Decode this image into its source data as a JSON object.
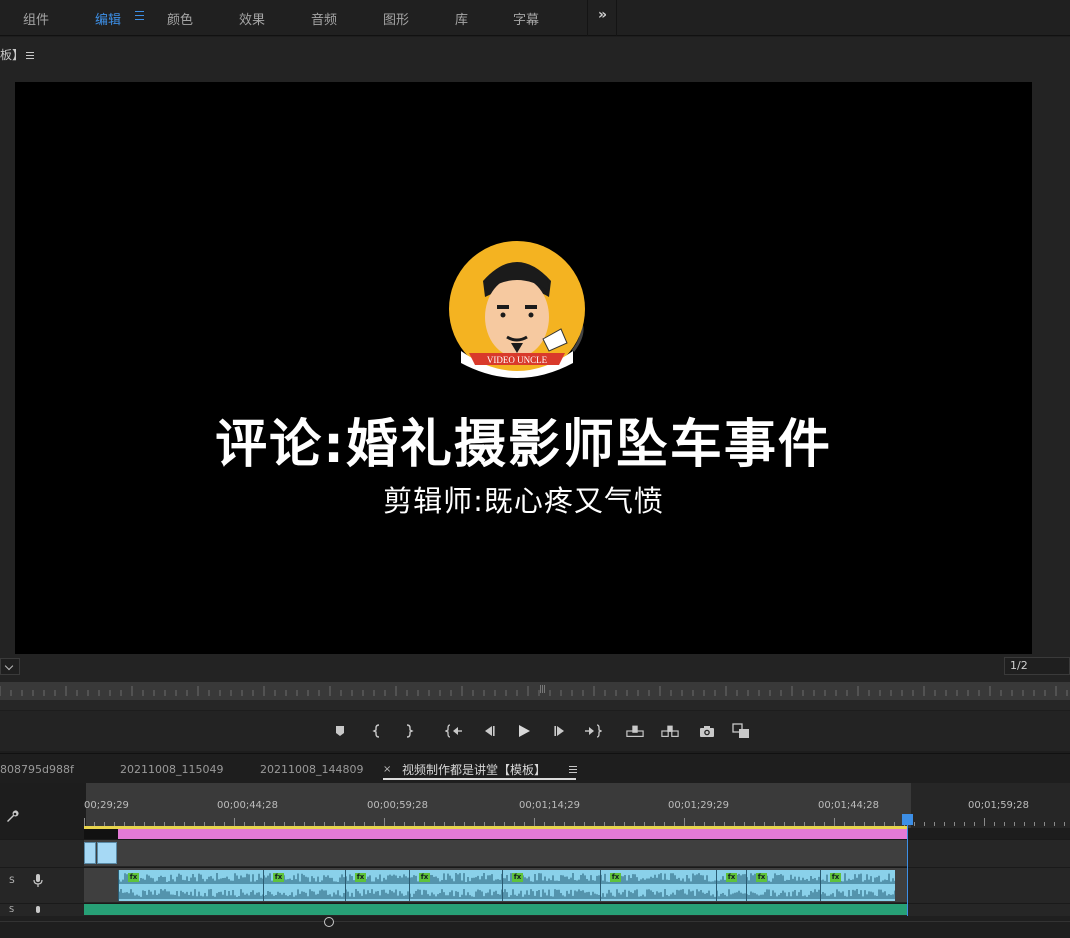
{
  "workspaces": {
    "items": [
      {
        "label": "组件"
      },
      {
        "label": "编辑"
      },
      {
        "label": "颜色"
      },
      {
        "label": "效果"
      },
      {
        "label": "音频"
      },
      {
        "label": "图形"
      },
      {
        "label": "库"
      },
      {
        "label": "字幕"
      }
    ],
    "active": "编辑",
    "accent_color": "#3d8fe6"
  },
  "program_monitor": {
    "title": "板】",
    "resolution": "1/2"
  },
  "video_frame": {
    "logo_text": "VIDEO UNCLE",
    "main_title": "评论:婚礼摄影师坠车事件",
    "sub_title": "剪辑师:既心疼又气愤"
  },
  "transport_icons": [
    "add-marker-icon",
    "mark-in-icon",
    "mark-out-icon",
    "go-to-in-icon",
    "step-back-icon",
    "play-icon",
    "step-forward-icon",
    "go-to-out-icon",
    "lift-icon",
    "extract-icon",
    "export-frame-icon",
    "comparison-view-icon"
  ],
  "timeline": {
    "tabs": [
      {
        "label": "808795d988f"
      },
      {
        "label": "20211008_115049"
      },
      {
        "label": "20211008_144809"
      },
      {
        "label": "视频制作都是讲堂【模板】"
      }
    ],
    "active_tab": "视频制作都是讲堂【模板】",
    "close_glyph": "×",
    "timecodes": [
      "00;29;29",
      "00;00;44;28",
      "00;00;59;28",
      "00;01;14;29",
      "00;01;29;29",
      "00;01;44;28",
      "00;01;59;28"
    ],
    "audio_track_label": "S",
    "audio_track_label2": "S",
    "colors": {
      "video_clip": "#a6d9f5",
      "audio_clip": "#8ad1ea",
      "pink_clip": "#e47ad6",
      "green_track": "#27a076",
      "playhead": "#3d8fe6",
      "work_area": "#e8d44d"
    }
  }
}
